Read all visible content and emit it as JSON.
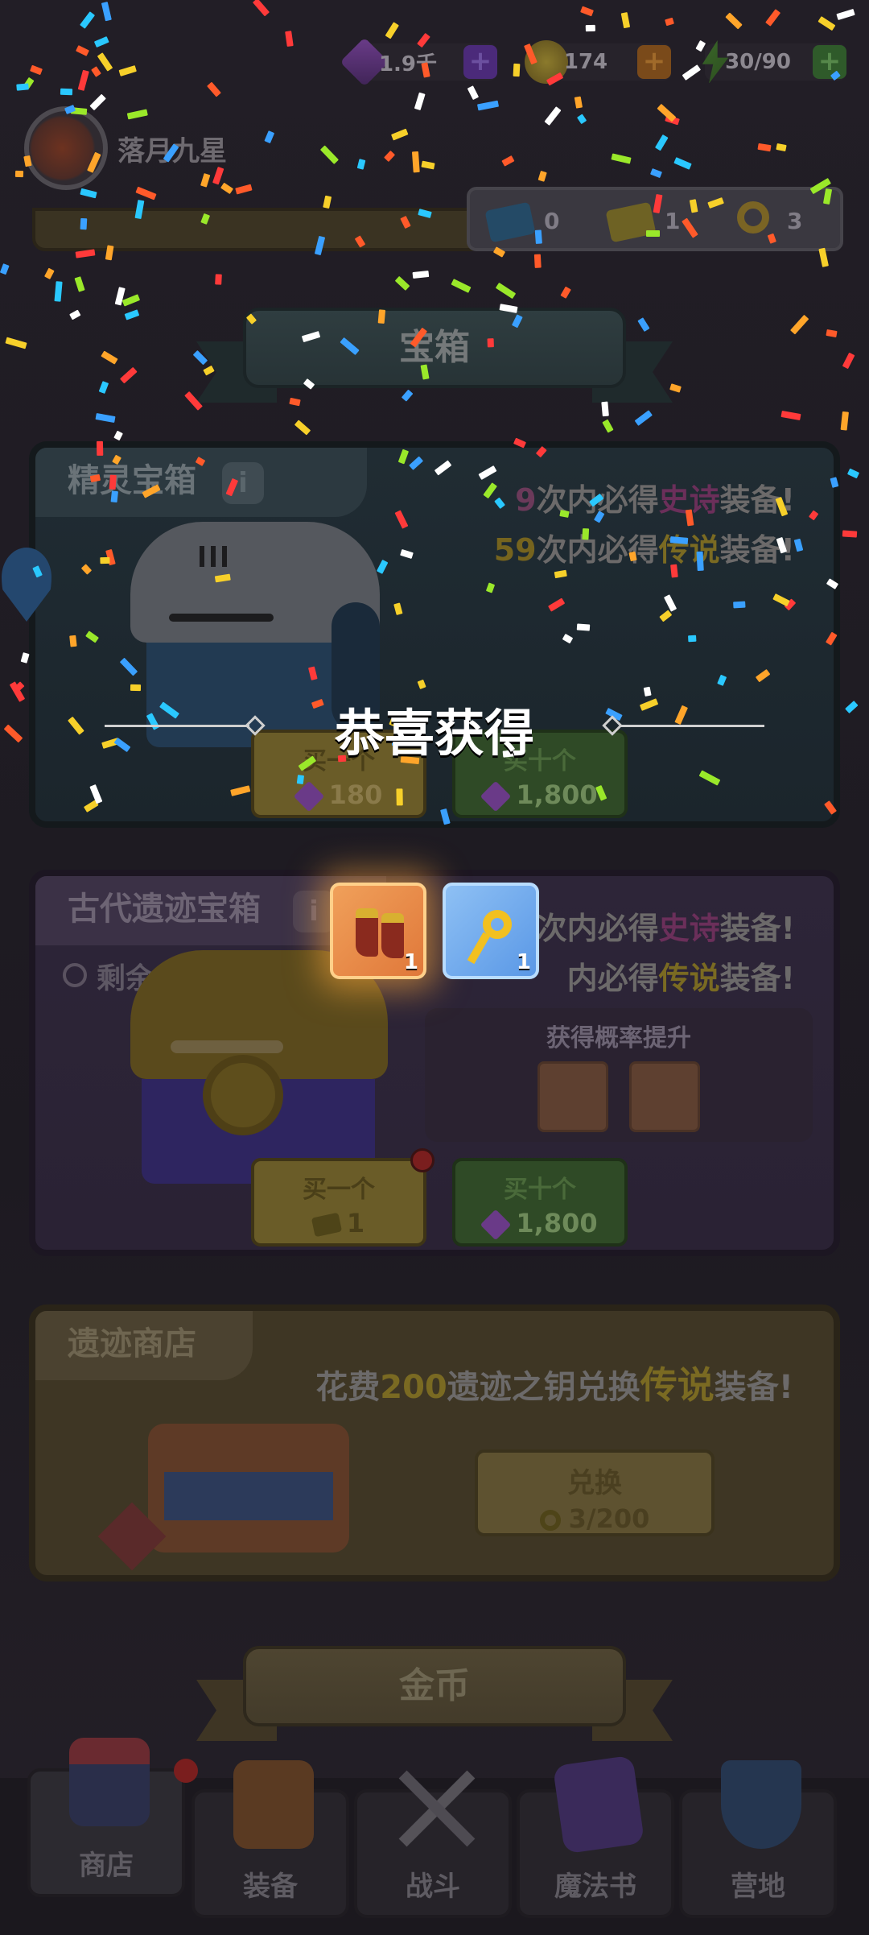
{
  "resources": {
    "gems": "1.9千",
    "gold": "174",
    "energy": "30/90",
    "plus": "+"
  },
  "player": {
    "name": "落月九星"
  },
  "tickets": {
    "blue_ticket": "0",
    "gold_ticket": "1",
    "ruin_key": "3"
  },
  "sections": {
    "chest_title": "宝箱",
    "gold_title": "金币"
  },
  "elf_chest": {
    "name": "精灵宝箱",
    "info": "i",
    "line1_num": "9",
    "line1_a": "次内必得",
    "line1_rarity": "史诗",
    "line1_b": "装备!",
    "line2_num": "59",
    "line2_a": "次内必得",
    "line2_rarity": "传说",
    "line2_b": "装备!",
    "buy_one_label": "买一个",
    "buy_one_price": "180",
    "buy_ten_label": "买十个",
    "buy_ten_price": "1,800"
  },
  "ancient_chest": {
    "name": "古代遗迹宝箱",
    "info": "i",
    "remaining": "剩余5天",
    "line1_a": "次内必得",
    "line1_rarity": "史诗",
    "line1_b": "装备!",
    "line2_a": "内必得",
    "line2_rarity": "传说",
    "line2_b": "装备!",
    "boost_title": "获得概率提升",
    "buy_one_label": "买一个",
    "buy_one_price": "1",
    "buy_ten_label": "买十个",
    "buy_ten_price": "1,800"
  },
  "ruin_shop": {
    "name": "遗迹商店",
    "desc_a": "花费",
    "desc_num": "200",
    "desc_b": "遗迹之钥兑换",
    "desc_rarity": "传说",
    "desc_c": "装备!",
    "exchange_label": "兑换",
    "exchange_progress": "3/200"
  },
  "overlay": {
    "title": "恭喜获得",
    "rewards": [
      {
        "item": "boots-icon",
        "count": "1"
      },
      {
        "item": "key-icon",
        "count": "1"
      }
    ]
  },
  "nav": [
    {
      "label": "商店"
    },
    {
      "label": "装备"
    },
    {
      "label": "战斗"
    },
    {
      "label": "魔法书"
    },
    {
      "label": "营地"
    }
  ],
  "colors": {
    "epic": "#7a3a6a",
    "legendary": "#8a7628",
    "gold_button": "#7a6a2c",
    "green_button": "#3f5a30"
  }
}
